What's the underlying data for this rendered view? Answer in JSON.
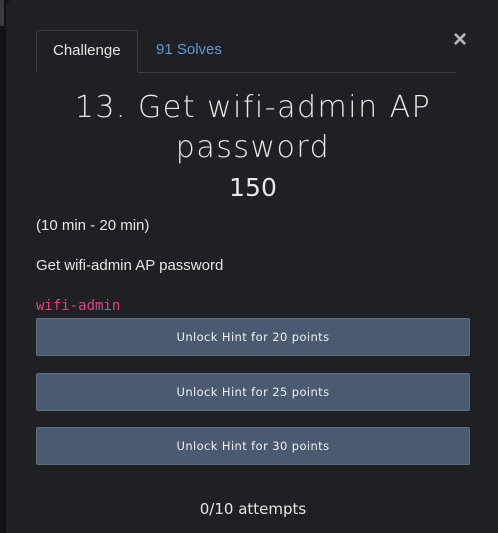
{
  "tabs": {
    "challenge_label": "Challenge",
    "solves_label": "91 Solves"
  },
  "close_glyph": "×",
  "challenge": {
    "title": "13. Get wifi-admin AP password",
    "points": "150",
    "duration": "(10 min - 20 min)",
    "description": "Get wifi-admin AP password",
    "code": "wifi-admin"
  },
  "hints": [
    {
      "label": "Unlock Hint for 20 points"
    },
    {
      "label": "Unlock Hint for 25 points"
    },
    {
      "label": "Unlock Hint for 30 points"
    }
  ],
  "attempts": "0/10 attempts",
  "colors": {
    "background": "#1f2024",
    "link": "#5b9bd5",
    "code": "#e83e8c",
    "hint_button": "#4a5a70"
  }
}
